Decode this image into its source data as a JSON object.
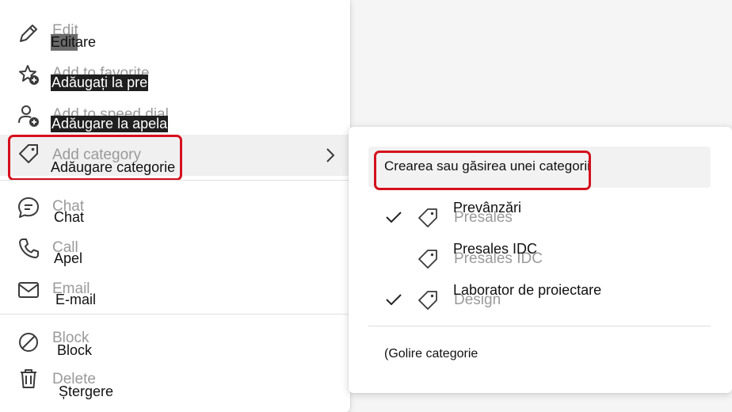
{
  "menu": {
    "items": [
      {
        "ghost": "Edit",
        "label": "Editare",
        "icon": "pencil-icon"
      },
      {
        "ghost": "Add to favorite",
        "label": "Adăugați la pre",
        "icon": "star-add-icon"
      },
      {
        "ghost": "Add to speed dial",
        "label": "Adăugare la apela",
        "icon": "person-add-icon"
      },
      {
        "ghost": "Add category",
        "label": "Adăugare categorie",
        "icon": "tag-icon",
        "chevron": "chevron-right-icon"
      },
      {
        "ghost": "Chat",
        "label": "Chat",
        "icon": "chat-icon"
      },
      {
        "ghost": "Call",
        "label": "Apel",
        "icon": "phone-icon"
      },
      {
        "ghost": "Email",
        "label": "E-mail",
        "icon": "mail-icon"
      },
      {
        "ghost": "Block",
        "label": "Block",
        "icon": "block-icon"
      },
      {
        "ghost": "Delete",
        "label": "Ștergere",
        "icon": "trash-icon"
      }
    ]
  },
  "submenu": {
    "search_label": "Crearea sau găsirea unei categorii",
    "categories": [
      {
        "label": "Prevânzări",
        "ghost": "Presales",
        "checked": true
      },
      {
        "label": "Presales IDC",
        "ghost": "Presales IDC",
        "checked": false
      },
      {
        "label": "Laborator de proiectare",
        "ghost": "Design",
        "checked": true
      }
    ],
    "clear_label": "(Golire categorie"
  },
  "colors": {
    "highlight": "#d50f1d",
    "active_row": "#f0f0f0",
    "icon": "#3b3b3b"
  }
}
